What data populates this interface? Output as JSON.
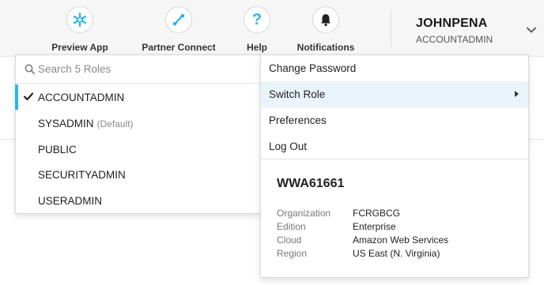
{
  "toolbar": {
    "preview_app": "Preview App",
    "partner_connect": "Partner Connect",
    "help": "Help",
    "notifications": "Notifications",
    "help_glyph": "?"
  },
  "user": {
    "name": "JOHNPENA",
    "role": "ACCOUNTADMIN"
  },
  "roles": {
    "search_placeholder": "Search 5 Roles",
    "items": [
      {
        "label": "ACCOUNTADMIN",
        "selected": true
      },
      {
        "label": "SYSADMIN",
        "tag": "(Default)"
      },
      {
        "label": "PUBLIC"
      },
      {
        "label": "SECURITYADMIN"
      },
      {
        "label": "USERADMIN"
      }
    ]
  },
  "menu": {
    "items": [
      {
        "label": "Change Password"
      },
      {
        "label": "Switch Role",
        "has_submenu": true,
        "highlighted": true
      },
      {
        "label": "Preferences"
      },
      {
        "label": "Log Out"
      }
    ]
  },
  "account": {
    "id": "WWA61661",
    "details": [
      {
        "key": "Organization",
        "value": "FCRGBCG"
      },
      {
        "key": "Edition",
        "value": "Enterprise"
      },
      {
        "key": "Cloud",
        "value": "Amazon Web Services"
      },
      {
        "key": "Region",
        "value": "US East (N. Virginia)"
      }
    ]
  },
  "colors": {
    "accent": "#29b5e8",
    "hover": "#eaf4fb",
    "topbar": "#f6f6f6"
  },
  "icons": [
    "snowflake-icon",
    "partner-connect-icon",
    "help-icon",
    "bell-icon",
    "chevron-down-icon",
    "search-icon",
    "checkmark-icon",
    "chevron-right-icon"
  ]
}
